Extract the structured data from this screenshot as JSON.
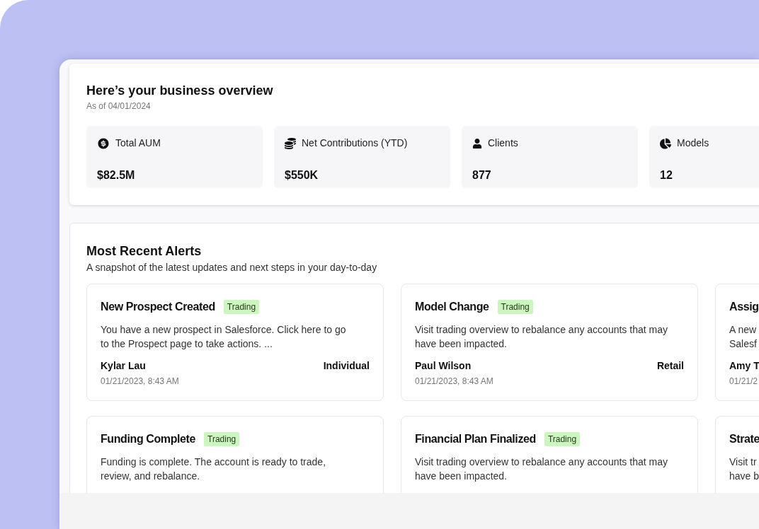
{
  "overview": {
    "title": "Here’s your business overview",
    "subtitle": "As of 04/01/2024",
    "stats": [
      {
        "kind": "dollar",
        "label": "Total AUM",
        "value": "$82.5M"
      },
      {
        "kind": "coins",
        "label": "Net Contributions (YTD)",
        "value": "$550K"
      },
      {
        "kind": "user",
        "label": "Clients",
        "value": "877"
      },
      {
        "kind": "pie",
        "label": "Models",
        "value": "12"
      }
    ]
  },
  "alerts": {
    "title": "Most Recent Alerts",
    "subtitle": "A snapshot of the latest updates and next steps in your day-to-day",
    "rows": [
      [
        {
          "title": "New Prospect Created",
          "tag": "Trading",
          "body": "You have a new prospect in Salesforce. Click here to go\nto the Prospect page to take actions. ...",
          "person": "Kylar Lau",
          "segment": "Individual",
          "time": "01/21/2023, 8:43 AM"
        },
        {
          "title": "Model Change",
          "tag": "Trading",
          "body": "Visit trading overview to rebalance any accounts that may\nhave been impacted.",
          "person": "Paul Wilson",
          "segment": "Retail",
          "time": "01/21/2023, 8:43 AM"
        },
        {
          "title": "Assig",
          "body": "A new\nSalesf",
          "person": "Amy T",
          "time": "01/21/2"
        }
      ],
      [
        {
          "title": "Funding Complete",
          "tag": "Trading",
          "body": "Funding is complete. The account is ready to trade,\nreview, and rebalance."
        },
        {
          "title": "Financial Plan Finalized",
          "tag": "Trading",
          "body": "Visit trading overview to rebalance any accounts that may\nhave been impacted."
        },
        {
          "title": "Strate",
          "body": "Visit tr\nhave b"
        }
      ]
    ]
  }
}
